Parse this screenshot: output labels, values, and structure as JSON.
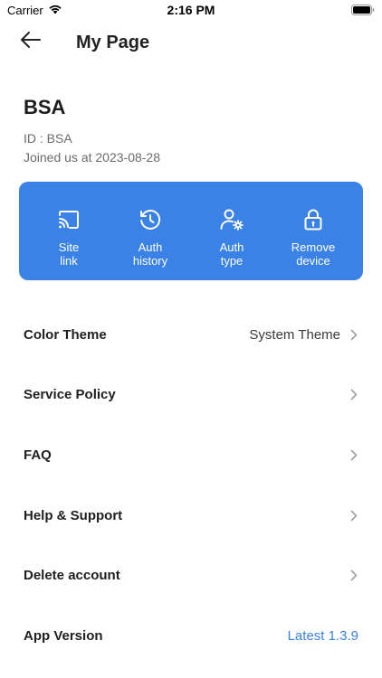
{
  "status_bar": {
    "carrier": "Carrier",
    "time": "2:16 PM"
  },
  "nav": {
    "title": "My Page"
  },
  "profile": {
    "name": "BSA",
    "id_text": "ID : BSA",
    "joined_text": "Joined us at 2023-08-28"
  },
  "actions": [
    {
      "label": "Site\nlink",
      "icon": "cast-icon"
    },
    {
      "label": "Auth\nhistory",
      "icon": "history-clock-icon"
    },
    {
      "label": "Auth\ntype",
      "icon": "user-gear-icon"
    },
    {
      "label": "Remove\ndevice",
      "icon": "lock-icon"
    }
  ],
  "menu": {
    "color_theme": {
      "label": "Color Theme",
      "value": "System Theme"
    },
    "service_policy": {
      "label": "Service Policy"
    },
    "faq": {
      "label": "FAQ"
    },
    "help_support": {
      "label": "Help & Support"
    },
    "delete_account": {
      "label": "Delete account"
    },
    "app_version": {
      "label": "App Version",
      "value": "Latest 1.3.9"
    }
  },
  "colors": {
    "accent": "#3b82e6",
    "card_text": "#ffffff",
    "secondary_text": "#6b6b6b"
  }
}
